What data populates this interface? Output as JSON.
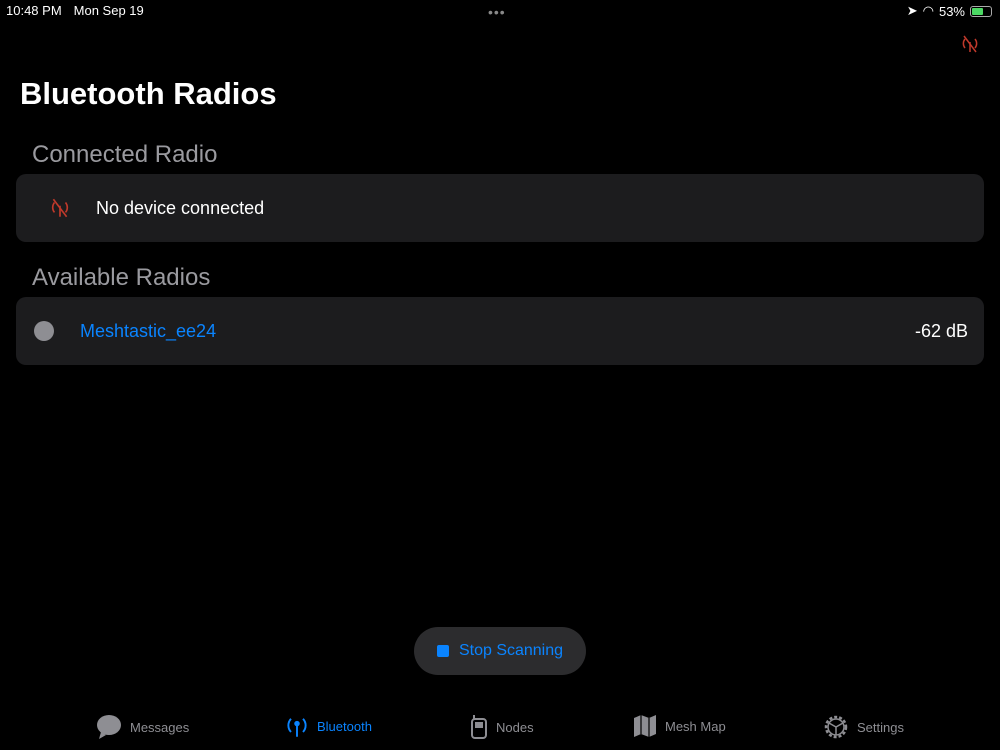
{
  "status_bar": {
    "time": "10:48 PM",
    "date": "Mon Sep 19",
    "battery": "53%"
  },
  "title": "Bluetooth Radios",
  "connected": {
    "header": "Connected Radio",
    "text": "No device connected"
  },
  "available": {
    "header": "Available Radios",
    "devices": [
      {
        "name": "Meshtastic_ee24",
        "rssi": "-62 dB"
      }
    ]
  },
  "scan_button": "Stop Scanning",
  "tabs": [
    {
      "label": "Messages"
    },
    {
      "label": "Bluetooth"
    },
    {
      "label": "Nodes"
    },
    {
      "label": "Mesh Map"
    },
    {
      "label": "Settings"
    }
  ],
  "colors": {
    "accent": "#0a84ff",
    "disconnected": "#c0392b"
  }
}
